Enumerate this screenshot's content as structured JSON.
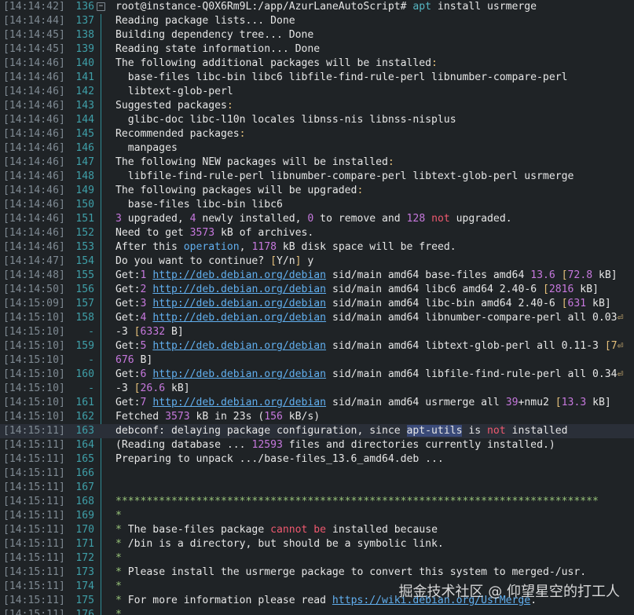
{
  "watermark": "掘金技术社区 @ 仰望星空的打工人",
  "lines": [
    {
      "ts": "[14:14:42]",
      "ln": "136",
      "fold": "⊟",
      "t": [
        [
          "root@instance-Q0X6Rm9L:/app/AzurLaneAutoScript# ",
          "w"
        ],
        [
          "apt",
          "c"
        ],
        [
          " install usrmerge",
          "w"
        ]
      ]
    },
    {
      "ts": "[14:14:44]",
      "ln": "137",
      "t": [
        [
          "Reading package lists... Done",
          "w"
        ]
      ]
    },
    {
      "ts": "[14:14:45]",
      "ln": "138",
      "t": [
        [
          "Building dependency tree... Done",
          "w"
        ]
      ]
    },
    {
      "ts": "[14:14:45]",
      "ln": "139",
      "t": [
        [
          "Reading state information... Done",
          "w"
        ]
      ]
    },
    {
      "ts": "[14:14:46]",
      "ln": "140",
      "t": [
        [
          "The following additional packages will be installed",
          "w"
        ],
        [
          ":",
          "y"
        ]
      ]
    },
    {
      "ts": "[14:14:46]",
      "ln": "141",
      "t": [
        [
          "  base-files libc-bin libc6 libfile-find-rule-perl libnumber-compare-perl",
          "w"
        ]
      ]
    },
    {
      "ts": "[14:14:46]",
      "ln": "142",
      "t": [
        [
          "  libtext-glob-perl",
          "w"
        ]
      ]
    },
    {
      "ts": "[14:14:46]",
      "ln": "143",
      "t": [
        [
          "Suggested packages",
          "w"
        ],
        [
          ":",
          "y"
        ]
      ]
    },
    {
      "ts": "[14:14:46]",
      "ln": "144",
      "t": [
        [
          "  glibc-doc libc-l10n locales libnss-nis libnss-nisplus",
          "w"
        ]
      ]
    },
    {
      "ts": "[14:14:46]",
      "ln": "145",
      "t": [
        [
          "Recommended packages",
          "w"
        ],
        [
          ":",
          "y"
        ]
      ]
    },
    {
      "ts": "[14:14:46]",
      "ln": "146",
      "t": [
        [
          "  manpages",
          "w"
        ]
      ]
    },
    {
      "ts": "[14:14:46]",
      "ln": "147",
      "t": [
        [
          "The following NEW packages will be installed",
          "w"
        ],
        [
          ":",
          "y"
        ]
      ]
    },
    {
      "ts": "[14:14:46]",
      "ln": "148",
      "t": [
        [
          "  libfile-find-rule-perl libnumber-compare-perl libtext-glob-perl usrmerge",
          "w"
        ]
      ]
    },
    {
      "ts": "[14:14:46]",
      "ln": "149",
      "t": [
        [
          "The following packages will be upgraded",
          "w"
        ],
        [
          ":",
          "y"
        ]
      ]
    },
    {
      "ts": "[14:14:46]",
      "ln": "150",
      "t": [
        [
          "  base-files libc-bin libc6",
          "w"
        ]
      ]
    },
    {
      "ts": "[14:14:46]",
      "ln": "151",
      "t": [
        [
          "3",
          "pu"
        ],
        [
          " upgraded, ",
          "w"
        ],
        [
          "4",
          "pu"
        ],
        [
          " newly installed, ",
          "w"
        ],
        [
          "0",
          "pu"
        ],
        [
          " to remove and ",
          "w"
        ],
        [
          "128",
          "pu"
        ],
        [
          " ",
          "w"
        ],
        [
          "not",
          "r"
        ],
        [
          " upgraded.",
          "w"
        ]
      ]
    },
    {
      "ts": "[14:14:46]",
      "ln": "152",
      "t": [
        [
          "Need to get ",
          "w"
        ],
        [
          "3573",
          "pu"
        ],
        [
          " kB of archives.",
          "w"
        ]
      ]
    },
    {
      "ts": "[14:14:46]",
      "ln": "153",
      "t": [
        [
          "After this ",
          "w"
        ],
        [
          "operation",
          "b"
        ],
        [
          ", ",
          "w"
        ],
        [
          "1178",
          "pu"
        ],
        [
          " kB disk space will be freed.",
          "w"
        ]
      ]
    },
    {
      "ts": "[14:14:47]",
      "ln": "154",
      "t": [
        [
          "Do you want to continue? ",
          "w"
        ],
        [
          "[",
          "y"
        ],
        [
          "Y/n",
          "w"
        ],
        [
          "]",
          "y"
        ],
        [
          " y",
          "w"
        ]
      ]
    },
    {
      "ts": "[14:14:48]",
      "ln": "155",
      "t": [
        [
          "Get:",
          "w"
        ],
        [
          "1",
          "pu"
        ],
        [
          " ",
          "w"
        ],
        [
          "http://deb.debian.org/debian",
          "u"
        ],
        [
          " sid/main amd64 base-files amd64 ",
          "w"
        ],
        [
          "13.6",
          "pu"
        ],
        [
          " ",
          "w"
        ],
        [
          "[",
          "y"
        ],
        [
          "72.8",
          "pu"
        ],
        [
          " kB]",
          "w"
        ]
      ]
    },
    {
      "ts": "[14:14:50]",
      "ln": "156",
      "t": [
        [
          "Get:",
          "w"
        ],
        [
          "2",
          "pu"
        ],
        [
          " ",
          "w"
        ],
        [
          "http://deb.debian.org/debian",
          "u"
        ],
        [
          " sid/main amd64 libc6 amd64 2.40-6 ",
          "w"
        ],
        [
          "[",
          "y"
        ],
        [
          "2816",
          "pu"
        ],
        [
          " kB]",
          "w"
        ]
      ]
    },
    {
      "ts": "[14:15:09]",
      "ln": "157",
      "t": [
        [
          "Get:",
          "w"
        ],
        [
          "3",
          "pu"
        ],
        [
          " ",
          "w"
        ],
        [
          "http://deb.debian.org/debian",
          "u"
        ],
        [
          " sid/main amd64 libc-bin amd64 2.40-6 ",
          "w"
        ],
        [
          "[",
          "y"
        ],
        [
          "631",
          "pu"
        ],
        [
          " kB]",
          "w"
        ]
      ]
    },
    {
      "ts": "[14:15:10]",
      "ln": "158",
      "t": [
        [
          "Get:",
          "w"
        ],
        [
          "4",
          "pu"
        ],
        [
          " ",
          "w"
        ],
        [
          "http://deb.debian.org/debian",
          "u"
        ],
        [
          " sid/main amd64 libnumber-compare-perl all 0.03",
          "w"
        ],
        [
          "⏎",
          "y"
        ]
      ]
    },
    {
      "ts": "[14:15:10]",
      "ln": "-",
      "t": [
        [
          "-3 ",
          "w"
        ],
        [
          "[",
          "y"
        ],
        [
          "6332",
          "pu"
        ],
        [
          " B]",
          "w"
        ]
      ]
    },
    {
      "ts": "[14:15:10]",
      "ln": "159",
      "t": [
        [
          "Get:",
          "w"
        ],
        [
          "5",
          "pu"
        ],
        [
          " ",
          "w"
        ],
        [
          "http://deb.debian.org/debian",
          "u"
        ],
        [
          " sid/main amd64 libtext-glob-perl all 0.11-3 ",
          "w"
        ],
        [
          "[7",
          "y"
        ],
        [
          "⏎",
          "y"
        ]
      ]
    },
    {
      "ts": "[14:15:10]",
      "ln": "-",
      "t": [
        [
          "676",
          "pu"
        ],
        [
          " B]",
          "w"
        ]
      ]
    },
    {
      "ts": "[14:15:10]",
      "ln": "160",
      "t": [
        [
          "Get:",
          "w"
        ],
        [
          "6",
          "pu"
        ],
        [
          " ",
          "w"
        ],
        [
          "http://deb.debian.org/debian",
          "u"
        ],
        [
          " sid/main amd64 libfile-find-rule-perl all 0.34",
          "w"
        ],
        [
          "⏎",
          "y"
        ]
      ]
    },
    {
      "ts": "[14:15:10]",
      "ln": "-",
      "t": [
        [
          "-3 ",
          "w"
        ],
        [
          "[",
          "y"
        ],
        [
          "26.6",
          "pu"
        ],
        [
          " kB]",
          "w"
        ]
      ]
    },
    {
      "ts": "[14:15:10]",
      "ln": "161",
      "t": [
        [
          "Get:",
          "w"
        ],
        [
          "7",
          "pu"
        ],
        [
          " ",
          "w"
        ],
        [
          "http://deb.debian.org/debian",
          "u"
        ],
        [
          " sid/main amd64 usrmerge all ",
          "w"
        ],
        [
          "39",
          "pu"
        ],
        [
          "+nmu2 ",
          "w"
        ],
        [
          "[",
          "y"
        ],
        [
          "13.3",
          "pu"
        ],
        [
          " kB]",
          "w"
        ]
      ]
    },
    {
      "ts": "[14:15:10]",
      "ln": "162",
      "t": [
        [
          "Fetched ",
          "w"
        ],
        [
          "3573",
          "pu"
        ],
        [
          " kB in 23s (",
          "w"
        ],
        [
          "156",
          "pu"
        ],
        [
          " kB/s)",
          "w"
        ]
      ]
    },
    {
      "ts": "[14:15:11]",
      "ln": "163",
      "hl": true,
      "t": [
        [
          "debconf: delaying package configuration, since ",
          "w"
        ],
        [
          "apt-utils",
          "sel"
        ],
        [
          " is ",
          "w"
        ],
        [
          "not",
          "r"
        ],
        [
          " installed",
          "w"
        ]
      ]
    },
    {
      "ts": "[14:15:11]",
      "ln": "164",
      "t": [
        [
          "(Reading database ... ",
          "w"
        ],
        [
          "12593",
          "pu"
        ],
        [
          " files and directories currently installed.)",
          "w"
        ]
      ]
    },
    {
      "ts": "[14:15:11]",
      "ln": "165",
      "t": [
        [
          "Preparing to unpack .../base-files_13.6_amd64.deb ...",
          "w"
        ]
      ]
    },
    {
      "ts": "[14:15:11]",
      "ln": "166",
      "t": []
    },
    {
      "ts": "[14:15:11]",
      "ln": "167",
      "t": []
    },
    {
      "ts": "[14:15:11]",
      "ln": "168",
      "t": [
        [
          "******************************************************************************",
          "g"
        ]
      ]
    },
    {
      "ts": "[14:15:11]",
      "ln": "169",
      "t": [
        [
          "*",
          "g"
        ]
      ]
    },
    {
      "ts": "[14:15:11]",
      "ln": "170",
      "t": [
        [
          "*",
          "g"
        ],
        [
          " The base-files package ",
          "w"
        ],
        [
          "cannot",
          "r"
        ],
        [
          " ",
          "w"
        ],
        [
          "be",
          "r"
        ],
        [
          " installed because",
          "w"
        ]
      ]
    },
    {
      "ts": "[14:15:11]",
      "ln": "171",
      "t": [
        [
          "*",
          "g"
        ],
        [
          " /bin is a directory, but should be a symbolic link.",
          "w"
        ]
      ]
    },
    {
      "ts": "[14:15:11]",
      "ln": "172",
      "t": [
        [
          "*",
          "g"
        ]
      ]
    },
    {
      "ts": "[14:15:11]",
      "ln": "173",
      "t": [
        [
          "*",
          "g"
        ],
        [
          " Please install the usrmerge package to convert this system to merged-/usr.",
          "w"
        ]
      ]
    },
    {
      "ts": "[14:15:11]",
      "ln": "174",
      "t": [
        [
          "*",
          "g"
        ]
      ]
    },
    {
      "ts": "[14:15:11]",
      "ln": "175",
      "t": [
        [
          "*",
          "g"
        ],
        [
          " For more information please read ",
          "w"
        ],
        [
          "https://wiki.debian.org/UsrMerge",
          "u"
        ],
        [
          ".",
          "w"
        ]
      ]
    },
    {
      "ts": "[14:15:11]",
      "ln": "176",
      "t": [
        [
          "*",
          "g"
        ]
      ]
    }
  ]
}
